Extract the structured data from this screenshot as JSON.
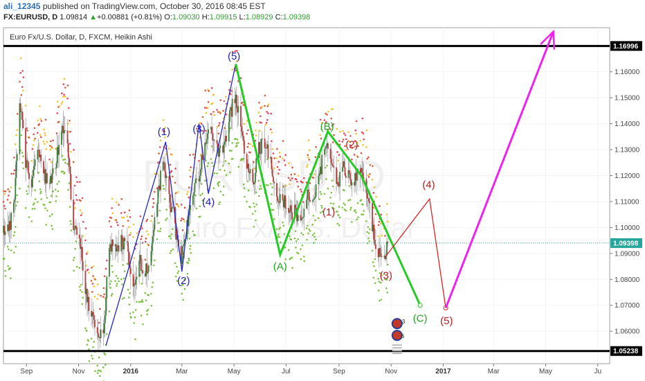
{
  "header": {
    "user": "ali_12345",
    "published_text": "published on TradingView.com, October 30, 2016 08:45 EST",
    "symbol": "FX:EURUSD, D",
    "last": "1.09814",
    "change": "+0.00881 (+0.81%)",
    "o_label": "O:",
    "o_value": "1.09030",
    "h_label": "H:",
    "h_value": "1.09915",
    "l_label": "L:",
    "l_value": "1.08929",
    "c_label": "C:",
    "c_value": "1.09398"
  },
  "chart_data": {
    "type": "line",
    "subtitle": "Euro Fx/U.S. Dollar, D, FXCM, Heikin Ashi",
    "watermark_symbol": "EURUSD, D",
    "watermark_name": "Euro Fx/U.S. Dollar",
    "ylim": [
      1.0475,
      1.177
    ],
    "y_ticks": [
      1.06,
      1.07,
      1.08,
      1.09,
      1.1,
      1.11,
      1.12,
      1.13,
      1.14,
      1.15,
      1.16
    ],
    "y_tick_labels": [
      "1.06000",
      "1.07000",
      "1.08000",
      "1.09000",
      "1.10000",
      "1.11000",
      "1.12000",
      "1.13000",
      "1.14000",
      "1.15000",
      "1.16000"
    ],
    "x_range": [
      "2015-08-05",
      "2017-07-15"
    ],
    "x_ticks": [
      {
        "date": "2015-09-01",
        "label": "Sep",
        "bold": false
      },
      {
        "date": "2015-11-01",
        "label": "Nov",
        "bold": false
      },
      {
        "date": "2016-01-01",
        "label": "2016",
        "bold": true
      },
      {
        "date": "2016-03-01",
        "label": "Mar",
        "bold": false
      },
      {
        "date": "2016-05-01",
        "label": "May",
        "bold": false
      },
      {
        "date": "2016-07-01",
        "label": "Jul",
        "bold": false
      },
      {
        "date": "2016-09-01",
        "label": "Sep",
        "bold": false
      },
      {
        "date": "2016-11-01",
        "label": "Nov",
        "bold": false
      },
      {
        "date": "2017-01-01",
        "label": "2017",
        "bold": true
      },
      {
        "date": "2017-03-01",
        "label": "Mar",
        "bold": false
      },
      {
        "date": "2017-05-01",
        "label": "May",
        "bold": false
      },
      {
        "date": "2017-07-01",
        "label": "Ju",
        "bold": false
      }
    ],
    "horizontal_levels": [
      {
        "value": 1.16996,
        "label": "1.16996"
      },
      {
        "value": 1.05238,
        "label": "1.05238"
      }
    ],
    "current_price": {
      "value": 1.09398,
      "label": "1.09398",
      "color": "#26a69a"
    },
    "price_series": {
      "name": "EURUSD Heikin Ashi (approx. close)",
      "points": [
        [
          "2015-08-05",
          1.098
        ],
        [
          "2015-08-12",
          1.1
        ],
        [
          "2015-08-18",
          1.11
        ],
        [
          "2015-08-24",
          1.15
        ],
        [
          "2015-08-31",
          1.125
        ],
        [
          "2015-09-07",
          1.118
        ],
        [
          "2015-09-14",
          1.13
        ],
        [
          "2015-09-21",
          1.12
        ],
        [
          "2015-09-28",
          1.118
        ],
        [
          "2015-10-05",
          1.125
        ],
        [
          "2015-10-12",
          1.138
        ],
        [
          "2015-10-19",
          1.132
        ],
        [
          "2015-10-26",
          1.1
        ],
        [
          "2015-11-02",
          1.095
        ],
        [
          "2015-11-09",
          1.076
        ],
        [
          "2015-11-16",
          1.066
        ],
        [
          "2015-11-23",
          1.059
        ],
        [
          "2015-11-30",
          1.057
        ],
        [
          "2015-12-07",
          1.094
        ],
        [
          "2015-12-14",
          1.092
        ],
        [
          "2015-12-21",
          1.095
        ],
        [
          "2015-12-28",
          1.092
        ],
        [
          "2016-01-04",
          1.078
        ],
        [
          "2016-01-11",
          1.088
        ],
        [
          "2016-01-18",
          1.082
        ],
        [
          "2016-01-25",
          1.09
        ],
        [
          "2016-02-01",
          1.11
        ],
        [
          "2016-02-08",
          1.127
        ],
        [
          "2016-02-15",
          1.112
        ],
        [
          "2016-02-22",
          1.1
        ],
        [
          "2016-02-29",
          1.087
        ],
        [
          "2016-03-07",
          1.1
        ],
        [
          "2016-03-14",
          1.115
        ],
        [
          "2016-03-21",
          1.119
        ],
        [
          "2016-03-28",
          1.133
        ],
        [
          "2016-04-04",
          1.137
        ],
        [
          "2016-04-11",
          1.13
        ],
        [
          "2016-04-18",
          1.128
        ],
        [
          "2016-04-25",
          1.142
        ],
        [
          "2016-05-02",
          1.15
        ],
        [
          "2016-05-09",
          1.14
        ],
        [
          "2016-05-16",
          1.125
        ],
        [
          "2016-05-23",
          1.116
        ],
        [
          "2016-05-30",
          1.13
        ],
        [
          "2016-06-06",
          1.133
        ],
        [
          "2016-06-13",
          1.125
        ],
        [
          "2016-06-20",
          1.11
        ],
        [
          "2016-06-27",
          1.111
        ],
        [
          "2016-07-04",
          1.106
        ],
        [
          "2016-07-11",
          1.106
        ],
        [
          "2016-07-18",
          1.1
        ],
        [
          "2016-07-25",
          1.112
        ],
        [
          "2016-08-01",
          1.113
        ],
        [
          "2016-08-08",
          1.117
        ],
        [
          "2016-08-15",
          1.132
        ],
        [
          "2016-08-22",
          1.128
        ],
        [
          "2016-08-29",
          1.115
        ],
        [
          "2016-09-05",
          1.123
        ],
        [
          "2016-09-12",
          1.12
        ],
        [
          "2016-09-19",
          1.118
        ],
        [
          "2016-09-26",
          1.122
        ],
        [
          "2016-10-03",
          1.115
        ],
        [
          "2016-10-10",
          1.1
        ],
        [
          "2016-10-17",
          1.09
        ],
        [
          "2016-10-24",
          1.09
        ],
        [
          "2016-10-30",
          1.094
        ]
      ]
    },
    "waves": [
      {
        "name": "blue impulse (1)-(5)",
        "color": "#2222cc",
        "points": [
          [
            "2015-12-03",
            1.0545
          ],
          [
            "2016-02-11",
            1.133
          ],
          [
            "2016-03-01",
            1.083
          ],
          [
            "2016-03-21",
            1.14
          ],
          [
            "2016-04-01",
            1.113
          ],
          [
            "2016-05-03",
            1.163
          ]
        ],
        "labels": [
          {
            "text": "(1)",
            "date": "2016-02-09",
            "value": 1.137
          },
          {
            "text": "(2)",
            "date": "2016-03-03",
            "value": 1.0795
          },
          {
            "text": "(3)",
            "date": "2016-03-21",
            "value": 1.138
          },
          {
            "text": "(4)",
            "date": "2016-04-01",
            "value": 1.1098
          },
          {
            "text": "(5)",
            "date": "2016-05-01",
            "value": 1.166
          }
        ]
      },
      {
        "name": "green correction (A)-(C)",
        "color": "#22cc22",
        "points": [
          [
            "2016-05-03",
            1.163
          ],
          [
            "2016-06-24",
            1.0895
          ],
          [
            "2016-08-19",
            1.137
          ],
          [
            "2016-09-27",
            1.12
          ],
          [
            "2016-12-05",
            1.07
          ]
        ],
        "labels": [
          {
            "text": "(A)",
            "date": "2016-06-24",
            "value": 1.085
          },
          {
            "text": "(B)",
            "date": "2016-08-18",
            "value": 1.139
          },
          {
            "text": "(C)",
            "date": "2016-12-05",
            "value": 1.065
          }
        ]
      },
      {
        "name": "red impulse (1)-(5)",
        "color": "#dd2222",
        "points": [
          [
            "2016-10-26",
            1.089
          ],
          [
            "2016-12-16",
            1.111
          ],
          [
            "2017-01-04",
            1.069
          ]
        ],
        "labels": [
          {
            "text": "(1)",
            "date": "2016-08-20",
            "value": 1.106
          },
          {
            "text": "(2)",
            "date": "2016-09-16",
            "value": 1.132
          },
          {
            "text": "(3)",
            "date": "2016-10-26",
            "value": 1.0815
          },
          {
            "text": "(4)",
            "date": "2016-12-15",
            "value": 1.1165
          },
          {
            "text": "(5)",
            "date": "2017-01-05",
            "value": 1.064
          }
        ]
      },
      {
        "name": "projection",
        "color": "#ee22ee",
        "points": [
          [
            "2017-01-04",
            1.069
          ],
          [
            "2017-05-10",
            1.1755
          ]
        ],
        "arrow": true,
        "labels": []
      }
    ],
    "event_marker": {
      "date": "2016-11-08",
      "value": 1.056,
      "top_text": "3",
      "bottom_text": "6"
    }
  }
}
